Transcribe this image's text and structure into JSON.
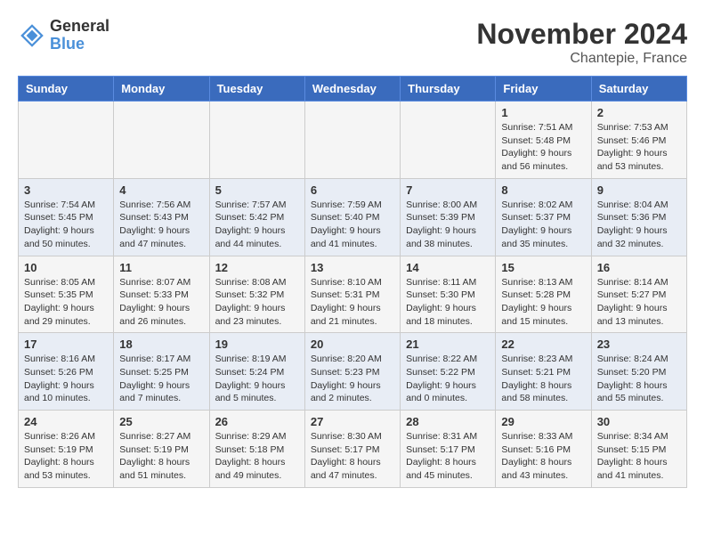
{
  "header": {
    "logo_line1": "General",
    "logo_line2": "Blue",
    "title": "November 2024",
    "subtitle": "Chantepie, France"
  },
  "weekdays": [
    "Sunday",
    "Monday",
    "Tuesday",
    "Wednesday",
    "Thursday",
    "Friday",
    "Saturday"
  ],
  "weeks": [
    [
      {
        "day": "",
        "info": ""
      },
      {
        "day": "",
        "info": ""
      },
      {
        "day": "",
        "info": ""
      },
      {
        "day": "",
        "info": ""
      },
      {
        "day": "",
        "info": ""
      },
      {
        "day": "1",
        "info": "Sunrise: 7:51 AM\nSunset: 5:48 PM\nDaylight: 9 hours and 56 minutes."
      },
      {
        "day": "2",
        "info": "Sunrise: 7:53 AM\nSunset: 5:46 PM\nDaylight: 9 hours and 53 minutes."
      }
    ],
    [
      {
        "day": "3",
        "info": "Sunrise: 7:54 AM\nSunset: 5:45 PM\nDaylight: 9 hours and 50 minutes."
      },
      {
        "day": "4",
        "info": "Sunrise: 7:56 AM\nSunset: 5:43 PM\nDaylight: 9 hours and 47 minutes."
      },
      {
        "day": "5",
        "info": "Sunrise: 7:57 AM\nSunset: 5:42 PM\nDaylight: 9 hours and 44 minutes."
      },
      {
        "day": "6",
        "info": "Sunrise: 7:59 AM\nSunset: 5:40 PM\nDaylight: 9 hours and 41 minutes."
      },
      {
        "day": "7",
        "info": "Sunrise: 8:00 AM\nSunset: 5:39 PM\nDaylight: 9 hours and 38 minutes."
      },
      {
        "day": "8",
        "info": "Sunrise: 8:02 AM\nSunset: 5:37 PM\nDaylight: 9 hours and 35 minutes."
      },
      {
        "day": "9",
        "info": "Sunrise: 8:04 AM\nSunset: 5:36 PM\nDaylight: 9 hours and 32 minutes."
      }
    ],
    [
      {
        "day": "10",
        "info": "Sunrise: 8:05 AM\nSunset: 5:35 PM\nDaylight: 9 hours and 29 minutes."
      },
      {
        "day": "11",
        "info": "Sunrise: 8:07 AM\nSunset: 5:33 PM\nDaylight: 9 hours and 26 minutes."
      },
      {
        "day": "12",
        "info": "Sunrise: 8:08 AM\nSunset: 5:32 PM\nDaylight: 9 hours and 23 minutes."
      },
      {
        "day": "13",
        "info": "Sunrise: 8:10 AM\nSunset: 5:31 PM\nDaylight: 9 hours and 21 minutes."
      },
      {
        "day": "14",
        "info": "Sunrise: 8:11 AM\nSunset: 5:30 PM\nDaylight: 9 hours and 18 minutes."
      },
      {
        "day": "15",
        "info": "Sunrise: 8:13 AM\nSunset: 5:28 PM\nDaylight: 9 hours and 15 minutes."
      },
      {
        "day": "16",
        "info": "Sunrise: 8:14 AM\nSunset: 5:27 PM\nDaylight: 9 hours and 13 minutes."
      }
    ],
    [
      {
        "day": "17",
        "info": "Sunrise: 8:16 AM\nSunset: 5:26 PM\nDaylight: 9 hours and 10 minutes."
      },
      {
        "day": "18",
        "info": "Sunrise: 8:17 AM\nSunset: 5:25 PM\nDaylight: 9 hours and 7 minutes."
      },
      {
        "day": "19",
        "info": "Sunrise: 8:19 AM\nSunset: 5:24 PM\nDaylight: 9 hours and 5 minutes."
      },
      {
        "day": "20",
        "info": "Sunrise: 8:20 AM\nSunset: 5:23 PM\nDaylight: 9 hours and 2 minutes."
      },
      {
        "day": "21",
        "info": "Sunrise: 8:22 AM\nSunset: 5:22 PM\nDaylight: 9 hours and 0 minutes."
      },
      {
        "day": "22",
        "info": "Sunrise: 8:23 AM\nSunset: 5:21 PM\nDaylight: 8 hours and 58 minutes."
      },
      {
        "day": "23",
        "info": "Sunrise: 8:24 AM\nSunset: 5:20 PM\nDaylight: 8 hours and 55 minutes."
      }
    ],
    [
      {
        "day": "24",
        "info": "Sunrise: 8:26 AM\nSunset: 5:19 PM\nDaylight: 8 hours and 53 minutes."
      },
      {
        "day": "25",
        "info": "Sunrise: 8:27 AM\nSunset: 5:19 PM\nDaylight: 8 hours and 51 minutes."
      },
      {
        "day": "26",
        "info": "Sunrise: 8:29 AM\nSunset: 5:18 PM\nDaylight: 8 hours and 49 minutes."
      },
      {
        "day": "27",
        "info": "Sunrise: 8:30 AM\nSunset: 5:17 PM\nDaylight: 8 hours and 47 minutes."
      },
      {
        "day": "28",
        "info": "Sunrise: 8:31 AM\nSunset: 5:17 PM\nDaylight: 8 hours and 45 minutes."
      },
      {
        "day": "29",
        "info": "Sunrise: 8:33 AM\nSunset: 5:16 PM\nDaylight: 8 hours and 43 minutes."
      },
      {
        "day": "30",
        "info": "Sunrise: 8:34 AM\nSunset: 5:15 PM\nDaylight: 8 hours and 41 minutes."
      }
    ]
  ]
}
